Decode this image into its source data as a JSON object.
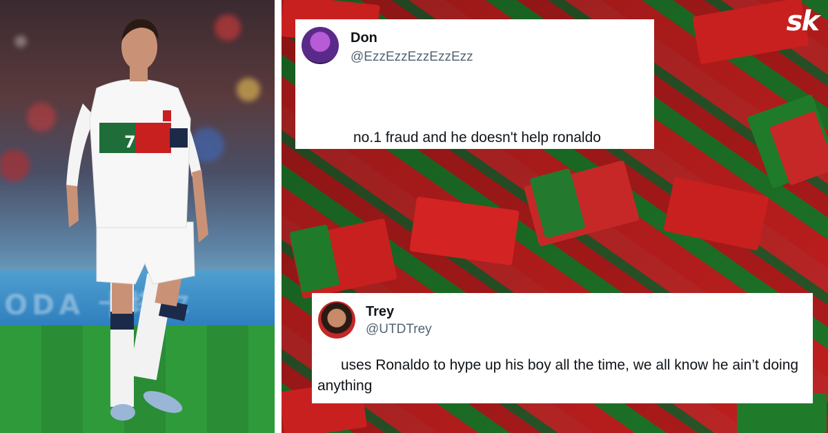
{
  "logo": {
    "text": "sk"
  },
  "tweets": [
    {
      "name": "Don",
      "handle": "@EzzEzzEzzEzzEzz",
      "text": "no.1 fraud and he doesn't help ronaldo"
    },
    {
      "name": "Trey",
      "handle": "@UTDTrey",
      "text": "uses Ronaldo to hype up his boy all the time, we all know he ain’t doing anything"
    }
  ],
  "player": {
    "shirt_number": "7"
  },
  "colors": {
    "portugal_red": "#c8201f",
    "portugal_green": "#1f7a2a",
    "card_bg": "#ffffff",
    "handle_gray": "#536471"
  }
}
